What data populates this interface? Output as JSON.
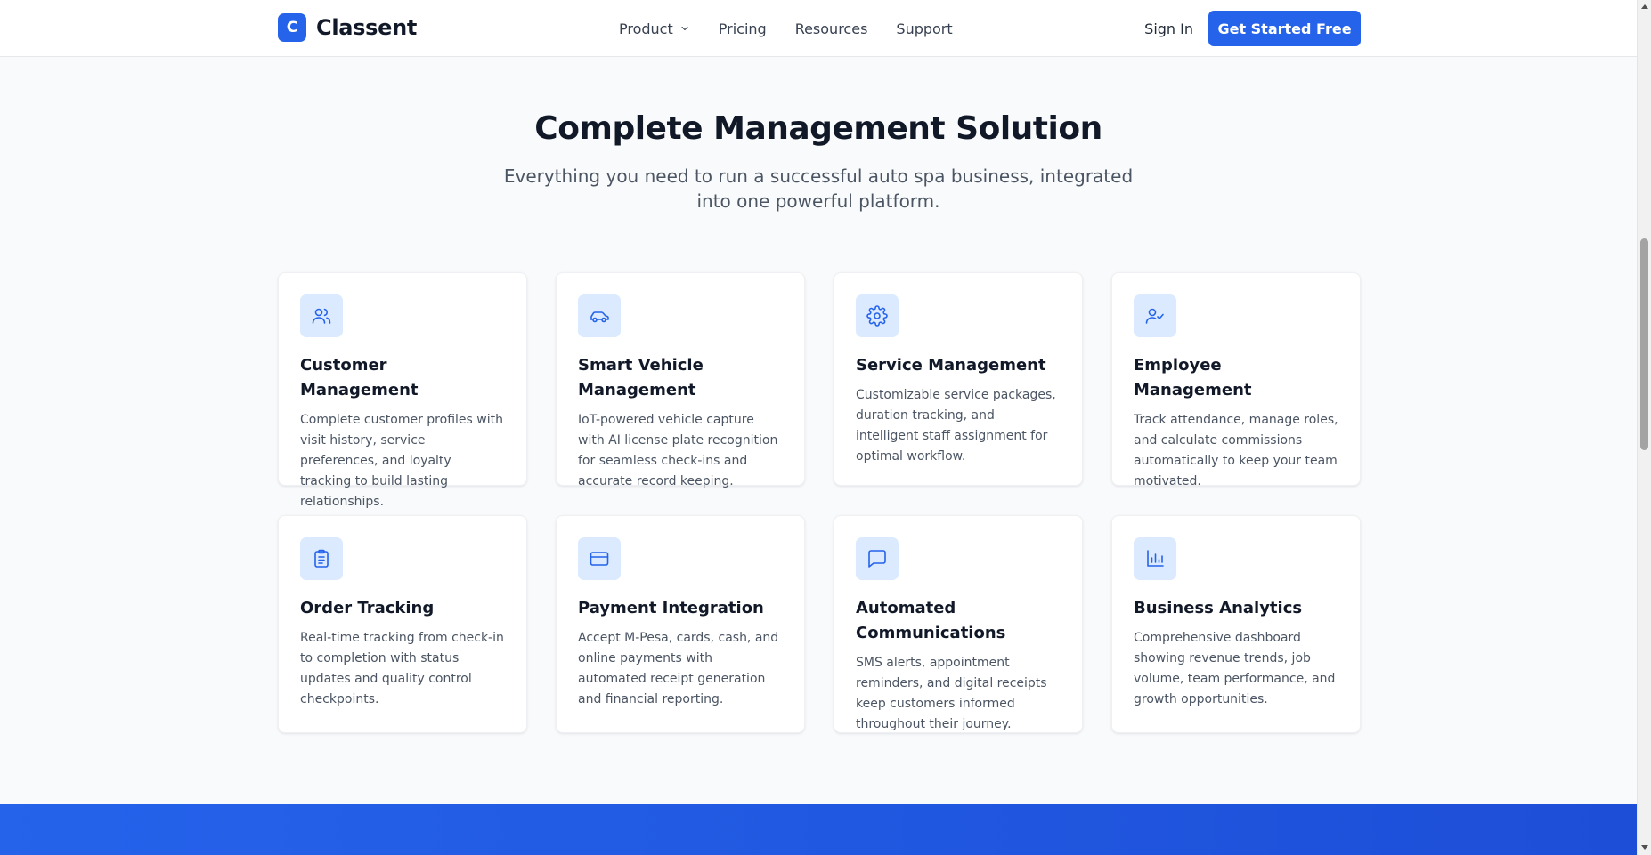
{
  "brand": {
    "logo_letter": "C",
    "name": "Classent",
    "accent": "#2563eb"
  },
  "nav": {
    "links": [
      {
        "label": "Product",
        "has_dropdown": true
      },
      {
        "label": "Pricing"
      },
      {
        "label": "Resources"
      },
      {
        "label": "Support"
      }
    ],
    "sign_in": "Sign In",
    "cta": "Get Started Free"
  },
  "section": {
    "title": "Complete Management Solution",
    "subtitle": "Everything you need to run a successful auto spa business, integrated into one powerful platform."
  },
  "features": [
    {
      "icon": "users-icon",
      "title": "Customer Management",
      "desc": "Complete customer profiles with visit history, service preferences, and loyalty tracking to build lasting relationships."
    },
    {
      "icon": "car-icon",
      "title": "Smart Vehicle Management",
      "desc": "IoT-powered vehicle capture with AI license plate recognition for seamless check-ins and accurate record keeping."
    },
    {
      "icon": "gear-icon",
      "title": "Service Management",
      "desc": "Customizable service packages, duration tracking, and intelligent staff assignment for optimal workflow."
    },
    {
      "icon": "user-check-icon",
      "title": "Employee Management",
      "desc": "Track attendance, manage roles, and calculate commissions automatically to keep your team motivated."
    },
    {
      "icon": "clipboard-icon",
      "title": "Order Tracking",
      "desc": "Real-time tracking from check-in to completion with status updates and quality control checkpoints."
    },
    {
      "icon": "credit-card-icon",
      "title": "Payment Integration",
      "desc": "Accept M-Pesa, cards, cash, and online payments with automated receipt generation and financial reporting."
    },
    {
      "icon": "message-icon",
      "title": "Automated Communications",
      "desc": "SMS alerts, appointment reminders, and digital receipts keep customers informed throughout their journey."
    },
    {
      "icon": "bar-chart-icon",
      "title": "Business Analytics",
      "desc": "Comprehensive dashboard showing revenue trends, job volume, team performance, and growth opportunities."
    }
  ]
}
